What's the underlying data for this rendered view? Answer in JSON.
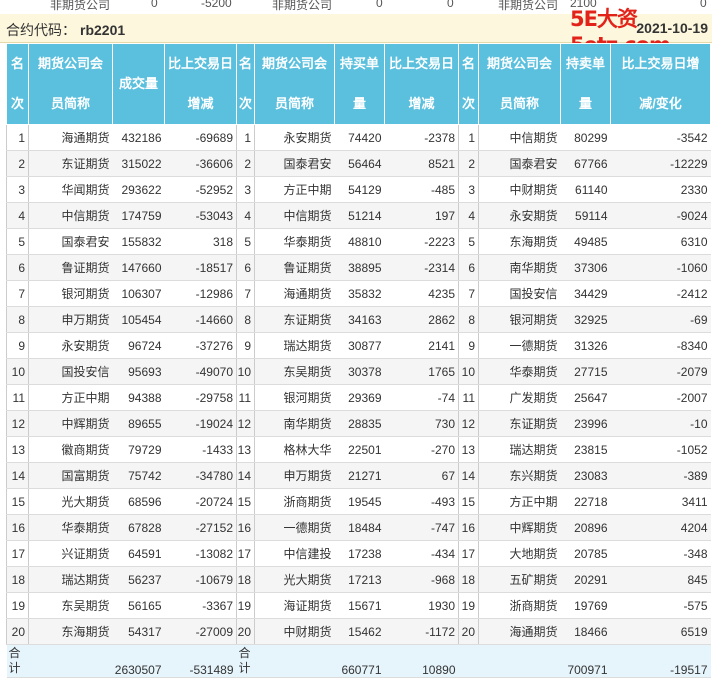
{
  "top_row": [
    "非期货公司",
    "0",
    "-5200",
    "非期货公司",
    "0",
    "0",
    "非期货公司",
    "2100",
    "0"
  ],
  "watermark": "5E大资5etz.com",
  "contract_label": "合约代码：",
  "contract_code": "rb2201",
  "date": "2021-10-19",
  "headers": {
    "rank_a": "名",
    "rank_b": "次",
    "name_a": "期货公司会",
    "name_b": "员简称",
    "vol": "成交量",
    "chg_a": "比上交易日",
    "chg_b": "增减",
    "long_a": "持买单",
    "long_b": "量",
    "short_a": "持卖单",
    "short_b": "量",
    "schg_a": "比上交易日增",
    "schg_b": "减/变化"
  },
  "rows": [
    {
      "r": "1",
      "n1": "海通期货",
      "v": "432186",
      "c1": "-69689",
      "n2": "永安期货",
      "l": "74420",
      "c2": "-2378",
      "n3": "中信期货",
      "s": "80299",
      "c3": "-3542"
    },
    {
      "r": "2",
      "n1": "东证期货",
      "v": "315022",
      "c1": "-36606",
      "n2": "国泰君安",
      "l": "56464",
      "c2": "8521",
      "n3": "国泰君安",
      "s": "67766",
      "c3": "-12229"
    },
    {
      "r": "3",
      "n1": "华闻期货",
      "v": "293622",
      "c1": "-52952",
      "n2": "方正中期",
      "l": "54129",
      "c2": "-485",
      "n3": "中财期货",
      "s": "61140",
      "c3": "2330"
    },
    {
      "r": "4",
      "n1": "中信期货",
      "v": "174759",
      "c1": "-53043",
      "n2": "中信期货",
      "l": "51214",
      "c2": "197",
      "n3": "永安期货",
      "s": "59114",
      "c3": "-9024"
    },
    {
      "r": "5",
      "n1": "国泰君安",
      "v": "155832",
      "c1": "318",
      "n2": "华泰期货",
      "l": "48810",
      "c2": "-2223",
      "n3": "东海期货",
      "s": "49485",
      "c3": "6310"
    },
    {
      "r": "6",
      "n1": "鲁证期货",
      "v": "147660",
      "c1": "-18517",
      "n2": "鲁证期货",
      "l": "38895",
      "c2": "-2314",
      "n3": "南华期货",
      "s": "37306",
      "c3": "-1060"
    },
    {
      "r": "7",
      "n1": "银河期货",
      "v": "106307",
      "c1": "-12986",
      "n2": "海通期货",
      "l": "35832",
      "c2": "4235",
      "n3": "国投安信",
      "s": "34429",
      "c3": "-2412"
    },
    {
      "r": "8",
      "n1": "申万期货",
      "v": "105454",
      "c1": "-14660",
      "n2": "东证期货",
      "l": "34163",
      "c2": "2862",
      "n3": "银河期货",
      "s": "32925",
      "c3": "-69"
    },
    {
      "r": "9",
      "n1": "永安期货",
      "v": "96724",
      "c1": "-37276",
      "n2": "瑞达期货",
      "l": "30877",
      "c2": "2141",
      "n3": "一德期货",
      "s": "31326",
      "c3": "-8340"
    },
    {
      "r": "10",
      "n1": "国投安信",
      "v": "95693",
      "c1": "-49070",
      "n2": "东吴期货",
      "l": "30378",
      "c2": "1765",
      "n3": "华泰期货",
      "s": "27715",
      "c3": "-2079"
    },
    {
      "r": "11",
      "n1": "方正中期",
      "v": "94388",
      "c1": "-29758",
      "n2": "银河期货",
      "l": "29369",
      "c2": "-74",
      "n3": "广发期货",
      "s": "25647",
      "c3": "-2007"
    },
    {
      "r": "12",
      "n1": "中辉期货",
      "v": "89655",
      "c1": "-19024",
      "n2": "南华期货",
      "l": "28835",
      "c2": "730",
      "n3": "东证期货",
      "s": "23996",
      "c3": "-10"
    },
    {
      "r": "13",
      "n1": "徽商期货",
      "v": "79729",
      "c1": "-1433",
      "n2": "格林大华",
      "l": "22501",
      "c2": "-270",
      "n3": "瑞达期货",
      "s": "23815",
      "c3": "-1052"
    },
    {
      "r": "14",
      "n1": "国富期货",
      "v": "75742",
      "c1": "-34780",
      "n2": "申万期货",
      "l": "21271",
      "c2": "67",
      "n3": "东兴期货",
      "s": "23083",
      "c3": "-389"
    },
    {
      "r": "15",
      "n1": "光大期货",
      "v": "68596",
      "c1": "-20724",
      "n2": "浙商期货",
      "l": "19545",
      "c2": "-493",
      "n3": "方正中期",
      "s": "22718",
      "c3": "3411"
    },
    {
      "r": "16",
      "n1": "华泰期货",
      "v": "67828",
      "c1": "-27152",
      "n2": "一德期货",
      "l": "18484",
      "c2": "-747",
      "n3": "中辉期货",
      "s": "20896",
      "c3": "4204"
    },
    {
      "r": "17",
      "n1": "兴证期货",
      "v": "64591",
      "c1": "-13082",
      "n2": "中信建投",
      "l": "17238",
      "c2": "-434",
      "n3": "大地期货",
      "s": "20785",
      "c3": "-348"
    },
    {
      "r": "18",
      "n1": "瑞达期货",
      "v": "56237",
      "c1": "-10679",
      "n2": "光大期货",
      "l": "17213",
      "c2": "-968",
      "n3": "五矿期货",
      "s": "20291",
      "c3": "845"
    },
    {
      "r": "19",
      "n1": "东吴期货",
      "v": "56165",
      "c1": "-3367",
      "n2": "海证期货",
      "l": "15671",
      "c2": "1930",
      "n3": "浙商期货",
      "s": "19769",
      "c3": "-575"
    },
    {
      "r": "20",
      "n1": "东海期货",
      "v": "54317",
      "c1": "-27009",
      "n2": "中财期货",
      "l": "15462",
      "c2": "-1172",
      "n3": "海通期货",
      "s": "18466",
      "c3": "6519"
    }
  ],
  "totals": {
    "label": "合计",
    "vol": "2630507",
    "vol_chg": "-531489",
    "long": "660771",
    "long_chg": "10890",
    "short": "700971",
    "short_chg": "-19517"
  }
}
